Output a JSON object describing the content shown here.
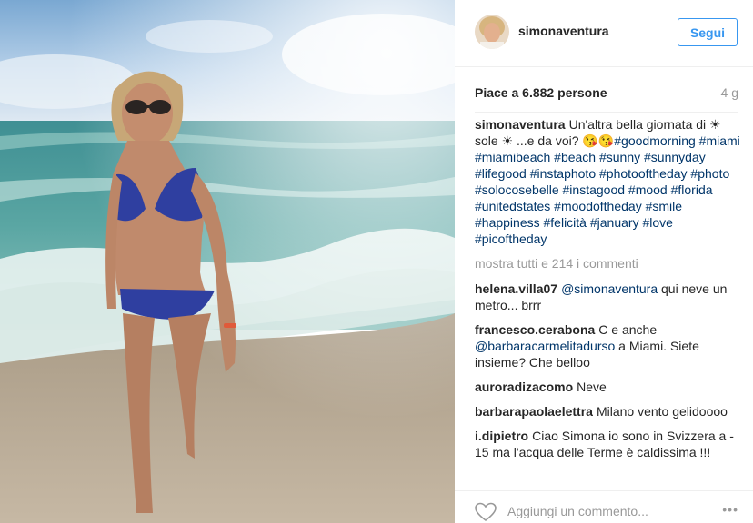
{
  "post": {
    "username": "simonaventura",
    "follow_label": "Segui",
    "likes": "Piace a 6.882 persone",
    "age": "4 g",
    "caption_text": "Un'altra bella giornata di ☀ sole ☀ ...e da voi? 😘😘",
    "caption_tags": "#goodmorning #miami #miamibeach #beach #sunny #sunnyday #lifegood #instaphoto #photooftheday #photo #solocosebelle #instagood #mood #florida #unitedstates #moodoftheday #smile #happiness #felicità #january #love #picoftheday",
    "view_all": "mostra tutti e 214 i commenti",
    "add_comment_placeholder": "Aggiungi un commento...",
    "more_icon": "•••"
  },
  "comments": [
    {
      "user": "helena.villa07",
      "mention": "@simonaventura",
      "text": "qui neve un metro... brrr"
    },
    {
      "user": "francesco.cerabona",
      "text_before": "C e anche",
      "mention": "@barbaracarmelitadurso",
      "text": "a Miami. Siete insieme? Che belloo"
    },
    {
      "user": "auroradizacomo",
      "text": "Neve"
    },
    {
      "user": "barbarapaolaelettra",
      "text": "Milano vento gelidoooo"
    },
    {
      "user": "i.dipietro",
      "text": "Ciao Simona io sono in Svizzera a - 15 ma l'acqua delle Terme è caldissima !!!"
    }
  ],
  "icons": {
    "heart": "heart-outline-icon",
    "avatar": "avatar-image",
    "photo": "beach-photo"
  },
  "colors": {
    "accent": "#3897f0",
    "hashtag": "#003569",
    "muted": "#999999",
    "text": "#262626"
  }
}
